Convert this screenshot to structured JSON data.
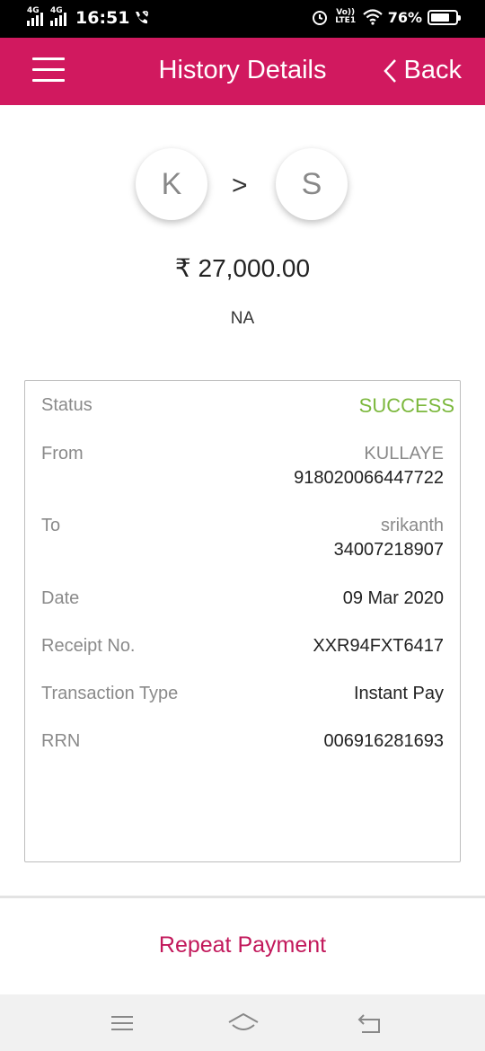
{
  "status_bar": {
    "network1": "4G",
    "network2": "4G",
    "time": "16:51",
    "volte": "Vo)) LTE1",
    "battery": "76%",
    "battery_level": 0.76
  },
  "header": {
    "title": "History Details",
    "back_label": "Back"
  },
  "transfer": {
    "from_initial": "K",
    "arrow": ">",
    "to_initial": "S",
    "amount": "₹ 27,000.00",
    "remark": "NA"
  },
  "details": {
    "status_label": "Status",
    "status_value": "SUCCESS",
    "from_label": "From",
    "from_name": "KULLAYE",
    "from_account": "918020066447722",
    "to_label": "To",
    "to_name": "srikanth",
    "to_account": "34007218907",
    "date_label": "Date",
    "date_value": "09 Mar 2020",
    "receipt_label": "Receipt No.",
    "receipt_value": "XXR94FXT6417",
    "type_label": "Transaction Type",
    "type_value": "Instant Pay",
    "rrn_label": "RRN",
    "rrn_value": "006916281693"
  },
  "actions": {
    "repeat_label": "Repeat Payment"
  },
  "colors": {
    "header": "#d1195f",
    "success": "#7cb83d",
    "accent_text": "#c2185b"
  }
}
